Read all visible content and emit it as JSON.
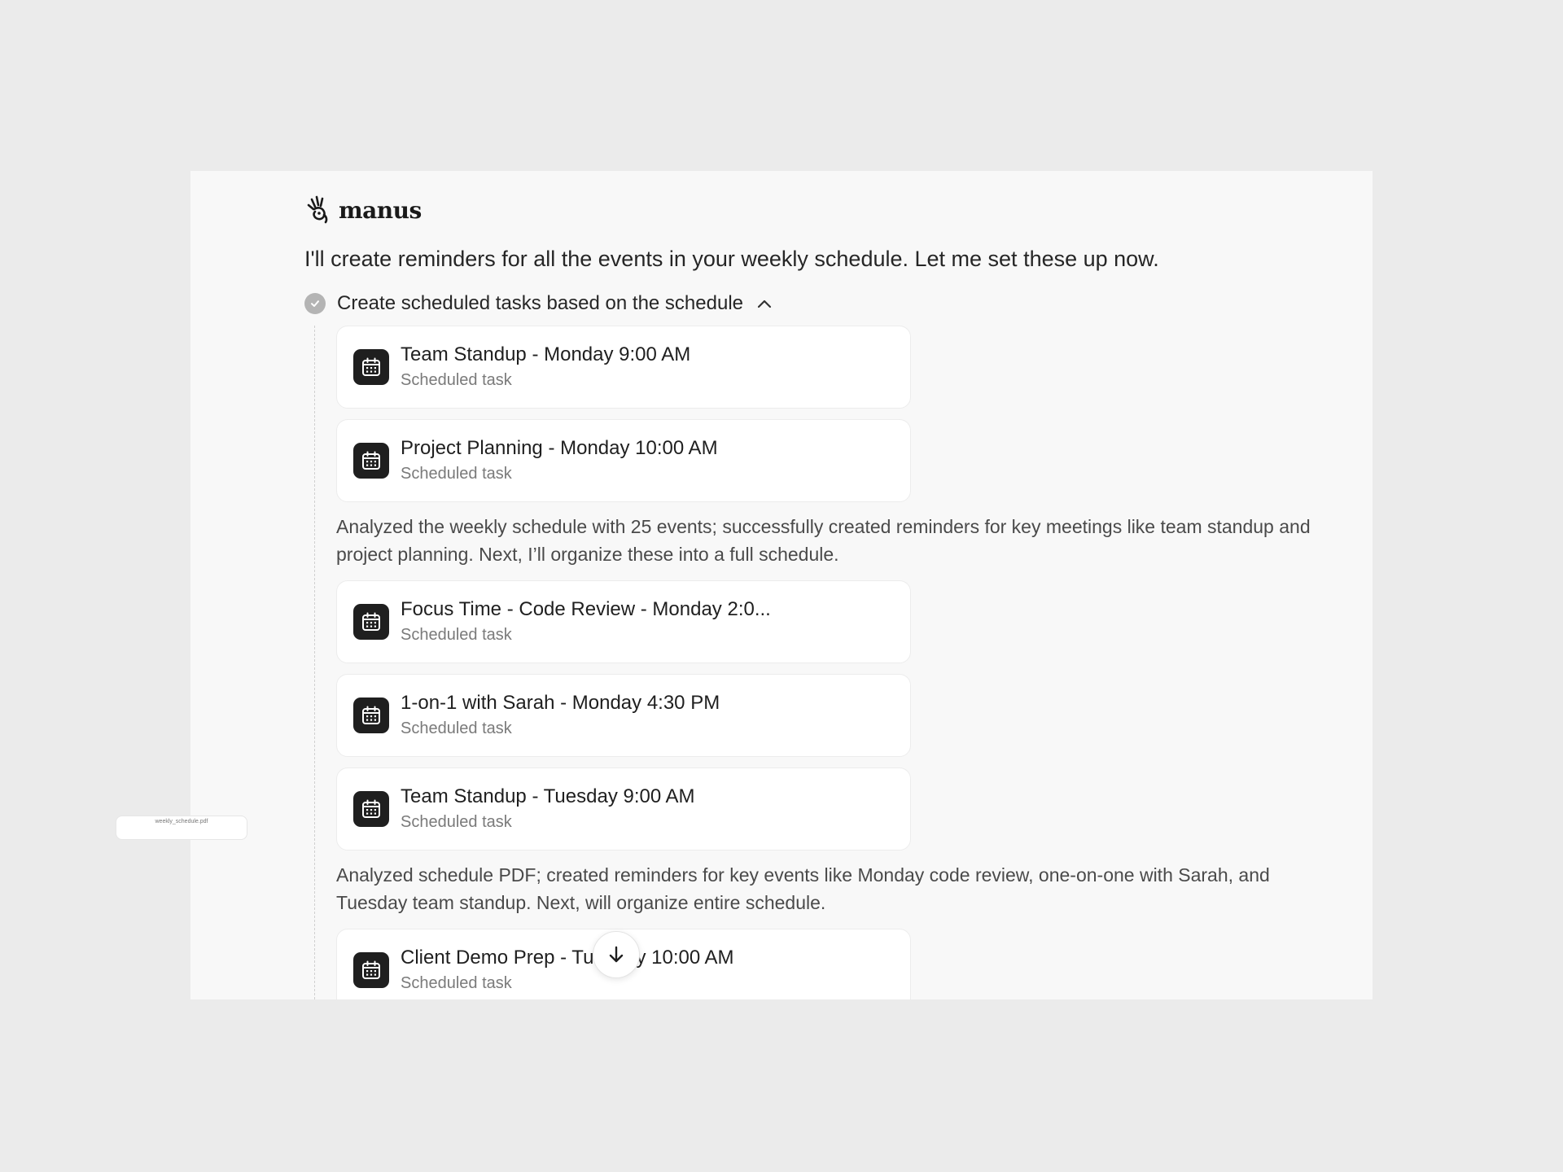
{
  "brand": {
    "name": "manus",
    "logo_icon": "manus-hand-logo-icon"
  },
  "message": {
    "intro": "I'll create reminders for all the events in your weekly schedule. Let me set these up now."
  },
  "step": {
    "title": "Create scheduled tasks based on the schedule",
    "status_icon": "check-circle-icon",
    "toggle_icon": "chevron-up-icon"
  },
  "task_subtitle": "Scheduled task",
  "tasks": [
    {
      "title": "Team Standup - Monday 9:00 AM",
      "subtitle": "Scheduled task"
    },
    {
      "title": "Project Planning - Monday 10:00 AM",
      "subtitle": "Scheduled task"
    },
    {
      "title": "Focus Time - Code Review - Monday 2:0...",
      "subtitle": "Scheduled task"
    },
    {
      "title": "1-on-1 with Sarah - Monday 4:30 PM",
      "subtitle": "Scheduled task"
    },
    {
      "title": "Team Standup - Tuesday 9:00 AM",
      "subtitle": "Scheduled task"
    },
    {
      "title": "Client Demo Prep - Tuesday 10:00 AM",
      "subtitle": "Scheduled task"
    }
  ],
  "summaries": [
    "Analyzed the weekly schedule with 25 events; successfully created reminders for key meetings like team standup and project planning. Next, I’ll organize these into a full schedule.",
    "Analyzed schedule PDF; created reminders for key events like Monday code review, one-on-one with Sarah, and Tuesday team standup. Next, will organize entire schedule."
  ],
  "attachment": {
    "filename": "weekly_schedule.pdf"
  },
  "colors": {
    "page_background": "#ebebeb",
    "panel_background": "#f8f8f8",
    "card_background": "#ffffff",
    "icon_background": "#1f1f1f",
    "check_circle": "#b4b4b4"
  }
}
